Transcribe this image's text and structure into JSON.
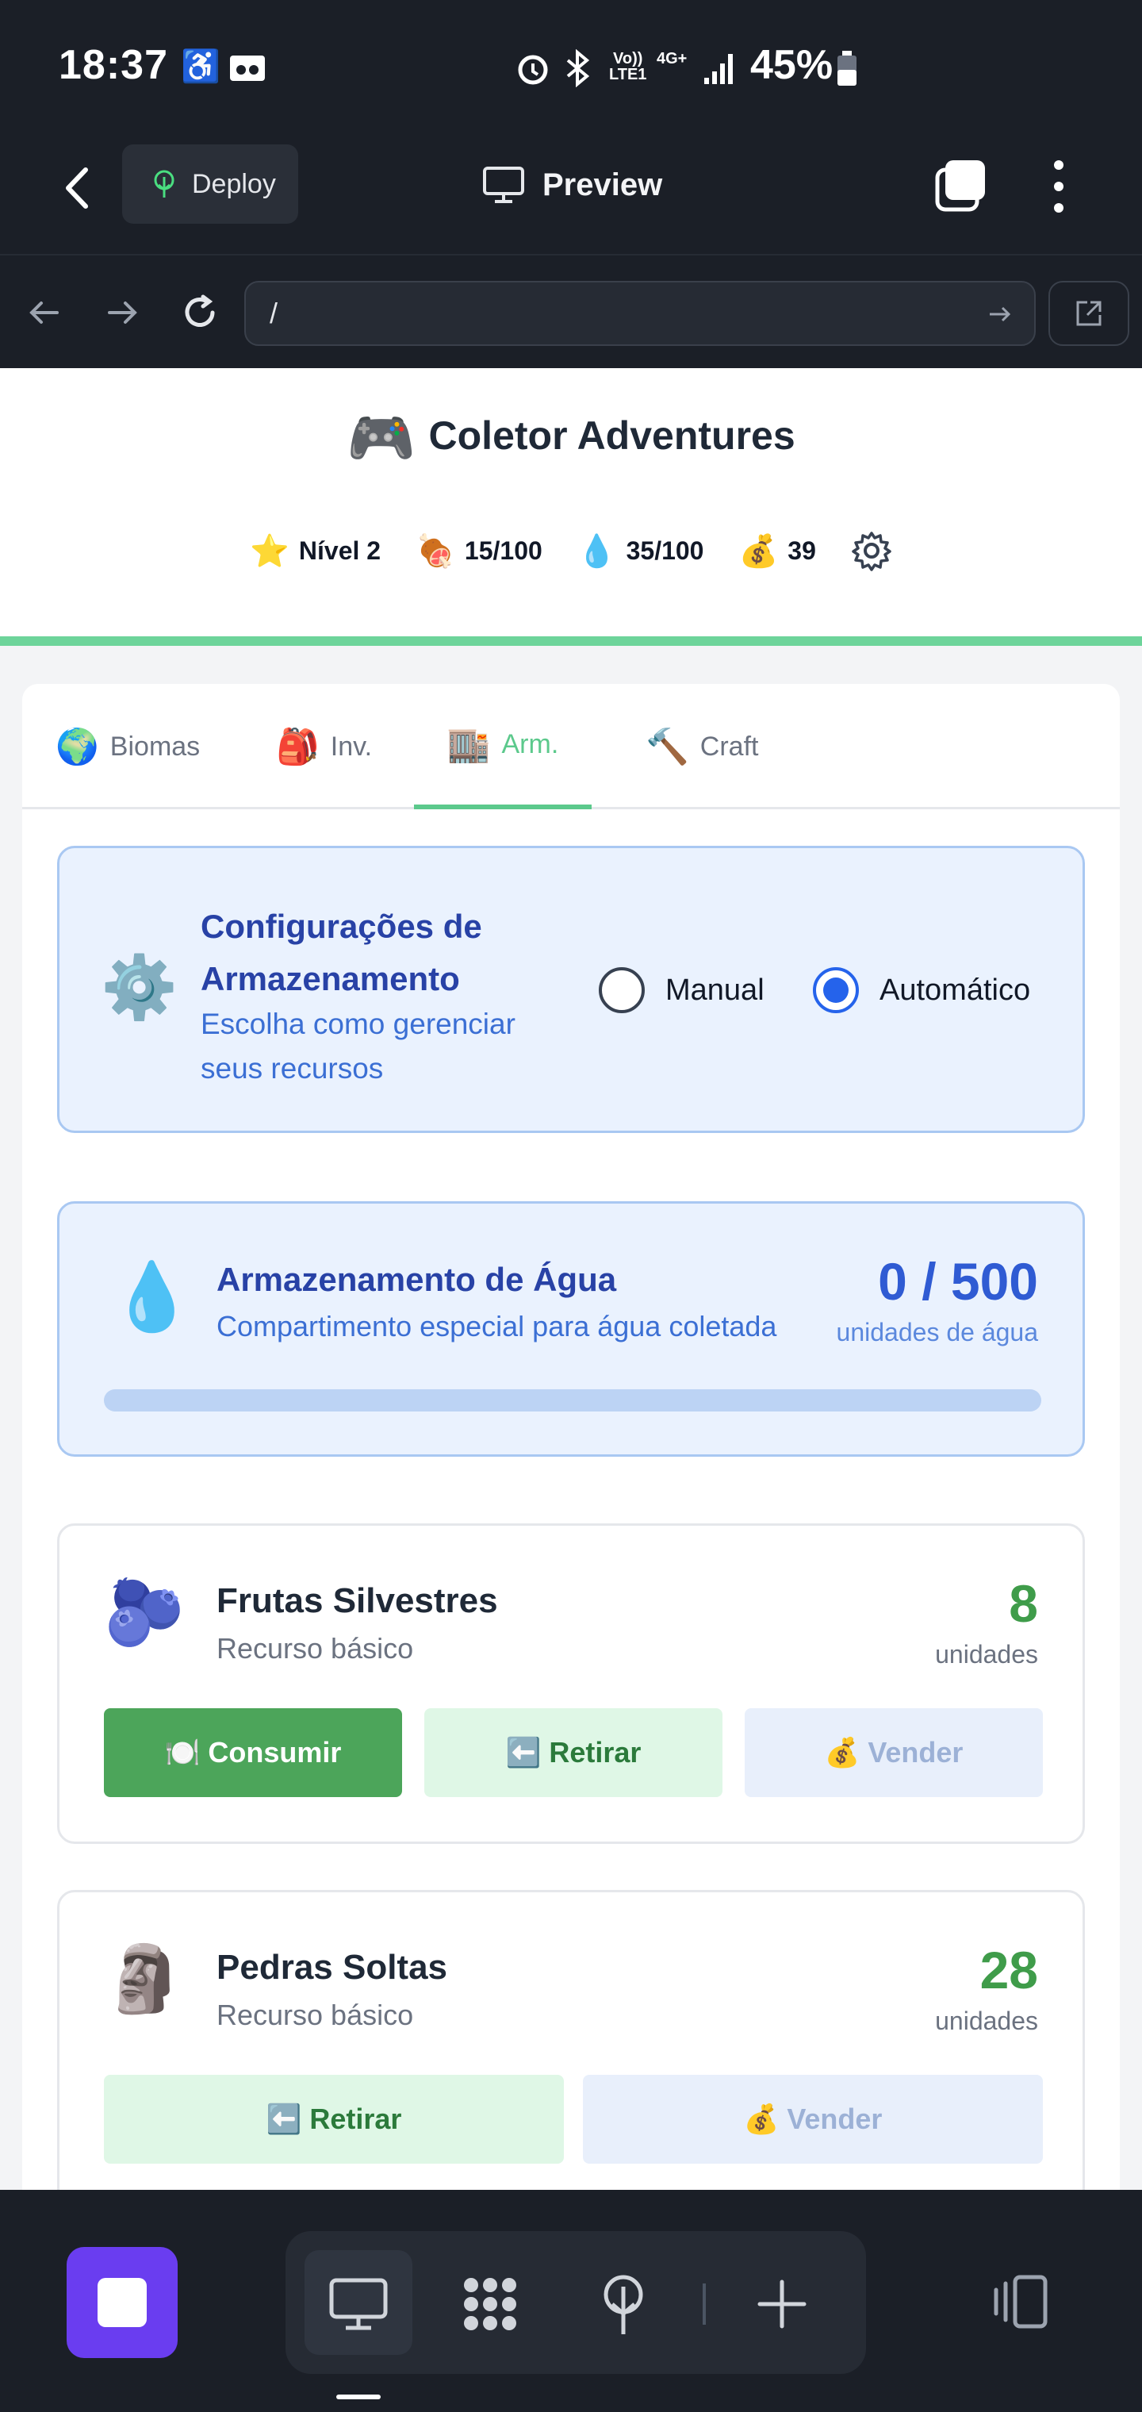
{
  "status_bar": {
    "time": "18:37",
    "volte": "Vo))",
    "lte": "LTE1",
    "network": "4G+",
    "battery": "45%"
  },
  "app_bar": {
    "deploy_label": "Deploy",
    "preview_label": "Preview"
  },
  "url_bar": {
    "url": "/"
  },
  "game": {
    "title_emoji": "🎮",
    "title": "Coletor Adventures",
    "stats": [
      {
        "icon": "⭐",
        "value": "Nível 2"
      },
      {
        "icon": "🍖",
        "value": "15/100"
      },
      {
        "icon": "💧",
        "value": "35/100"
      },
      {
        "icon": "💰",
        "value": "39"
      }
    ]
  },
  "tabs": [
    {
      "icon": "🌍",
      "label": "Biomas"
    },
    {
      "icon": "🎒",
      "label": "Inv."
    },
    {
      "icon": "🏬",
      "label": "Arm."
    },
    {
      "icon": "🔨",
      "label": "Craft"
    }
  ],
  "storage_config": {
    "icon": "⚙️",
    "title": "Configurações de Armazenamento",
    "subtitle": "Escolha como gerenciar seus recursos",
    "options": [
      "Manual",
      "Automático"
    ],
    "selected": "Automático"
  },
  "water_storage": {
    "icon": "💧",
    "title": "Armazenamento de Água",
    "subtitle": "Compartimento especial para água coletada",
    "value": "0 / 500",
    "unit": "unidades de água",
    "fill_fraction": 0
  },
  "resources": [
    {
      "icon": "🫐",
      "name": "Frutas Silvestres",
      "type": "Recurso básico",
      "count": "8",
      "unit": "unidades",
      "consume": "🍽️ Consumir",
      "retire": "⬅️ Retirar",
      "sell": "💰 Vender"
    },
    {
      "icon": "🗿",
      "name": "Pedras Soltas",
      "type": "Recurso básico",
      "count": "28",
      "unit": "unidades",
      "retire": "⬅️ Retirar",
      "sell": "💰 Vender"
    }
  ],
  "colors": {
    "accent": "#5cc98c",
    "primary_blue": "#2563eb",
    "stop": "#6a3df0"
  }
}
